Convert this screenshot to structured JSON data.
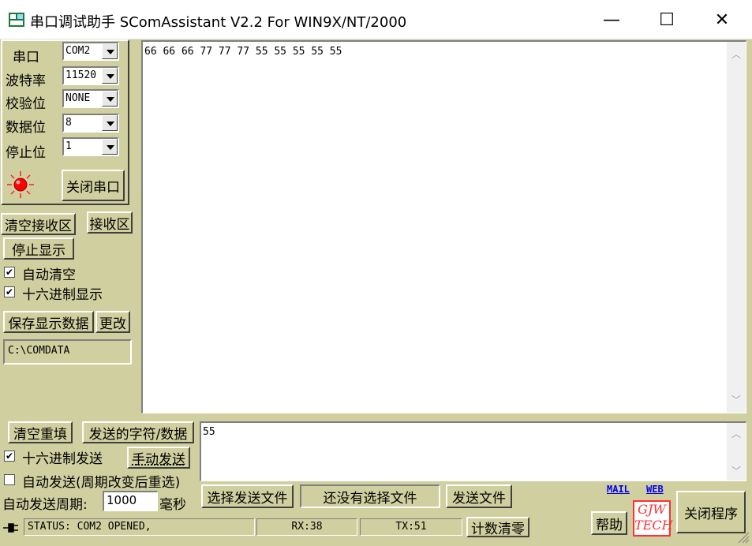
{
  "window": {
    "title": "串口调试助手 SComAssistant V2.2 For WIN9X/NT/2000",
    "minimize": "—",
    "maximize": "☐",
    "close": "✕"
  },
  "port_settings": {
    "port_label": "串口",
    "port_value": "COM2",
    "baud_label": "波特率",
    "baud_value": "11520",
    "parity_label": "校验位",
    "parity_value": "NONE",
    "databits_label": "数据位",
    "databits_value": "8",
    "stopbits_label": "停止位",
    "stopbits_value": "1",
    "close_port_label": "关闭串口",
    "status_color": "#ff0000"
  },
  "receive": {
    "clear_label": "清空接收区",
    "area_label": "接收区",
    "stop_display_label": "停止显示",
    "auto_clear_label": "自动清空",
    "auto_clear_checked": "✔",
    "hex_display_label": "十六进制显示",
    "hex_display_checked": "✔",
    "save_label": "保存显示数据",
    "change_label": "更改",
    "path_value": "C:\\COMDATA",
    "content": "66 66 66 77 77 77 55 55 55 55 55"
  },
  "send": {
    "clear_resend_label": "清空重填",
    "chars_label": "发送的字符/数据",
    "hex_send_label": "十六进制发送",
    "hex_send_checked": "✔",
    "manual_send_label": "手动发送",
    "auto_send_label": "自动发送(周期改变后重选)",
    "auto_send_checked": "",
    "period_label": "自动发送周期:",
    "period_value": "1000",
    "period_unit": "毫秒",
    "content": "55",
    "select_file_label": "选择发送文件",
    "no_file_label": "还没有选择文件",
    "send_file_label": "发送文件"
  },
  "links": {
    "mail": "MAIL",
    "web": "WEB",
    "logo_line1": "GJW",
    "logo_line2": "TECH"
  },
  "bottom": {
    "help_label": "帮助",
    "exit_label": "关闭程序",
    "status_text": "STATUS: COM2 OPENED,",
    "rx_text": "RX:38",
    "tx_text": "TX:51",
    "reset_count_label": "计数清零"
  }
}
